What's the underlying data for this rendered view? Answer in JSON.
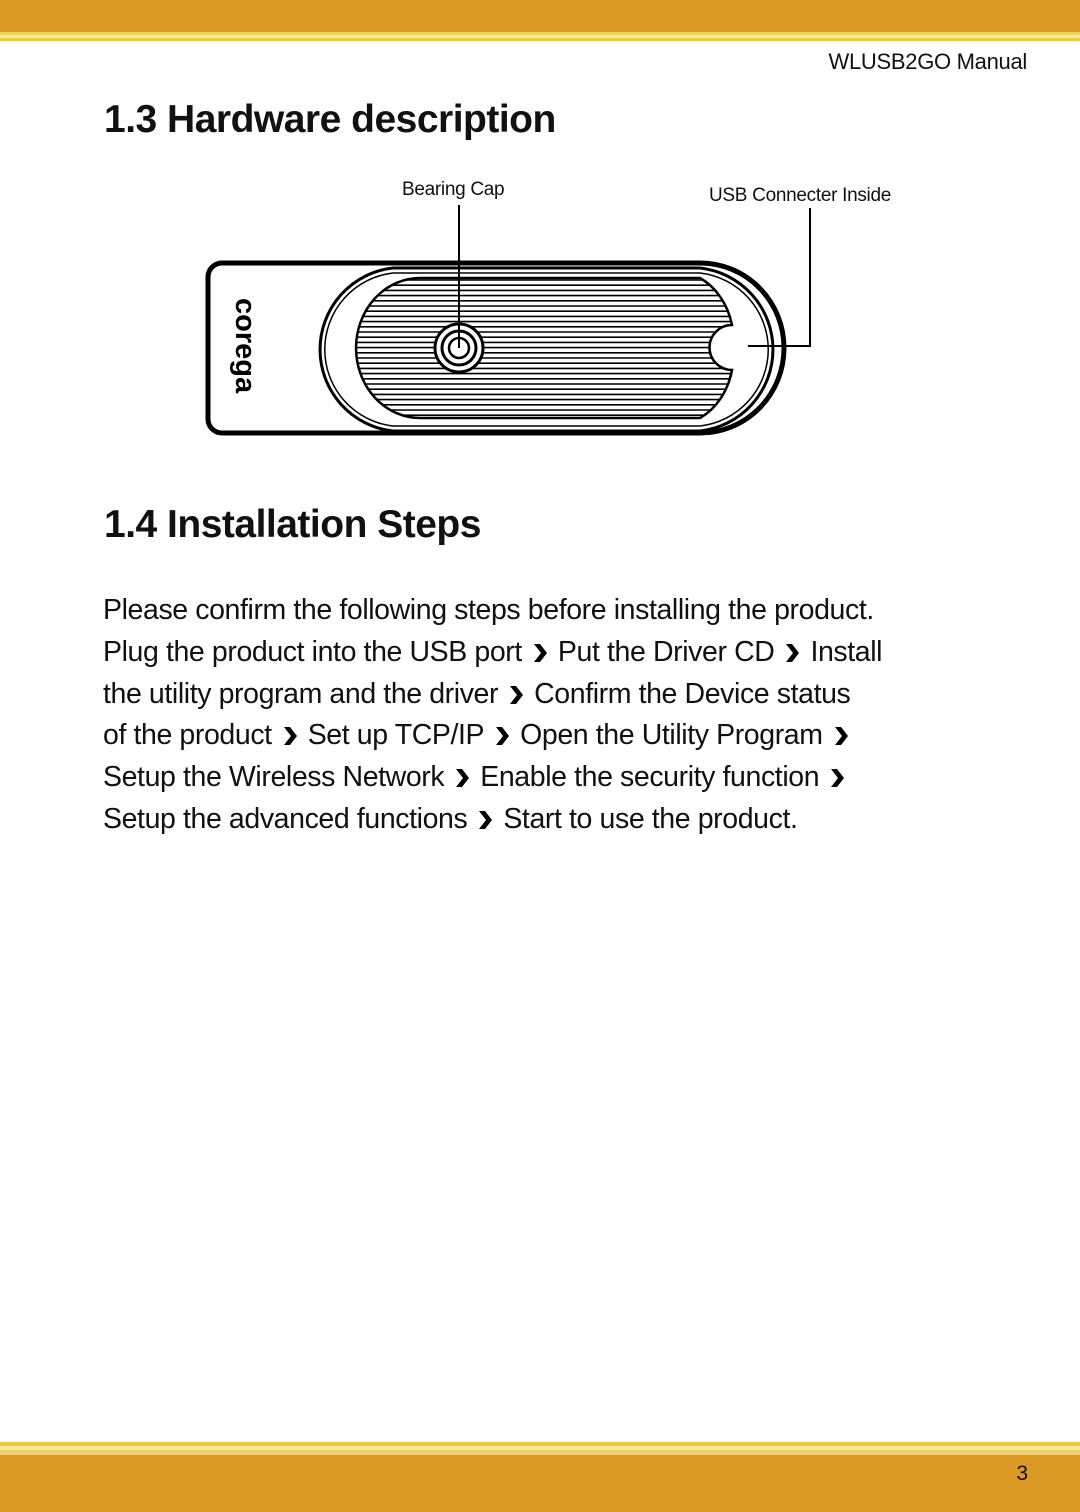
{
  "header": {
    "title": "WLUSB2GO  Manual"
  },
  "colors": {
    "band": "#da9a24",
    "stripe_light": "#f4e27a",
    "stripe_mid": "#eccb4a"
  },
  "hardware": {
    "heading": "1.3 Hardware description",
    "labels": {
      "bearing_cap": "Bearing Cap",
      "usb": "USB Connecter Inside"
    },
    "logo": "corega"
  },
  "install": {
    "heading": "1.4 Installation Steps",
    "lines": [
      [
        "Please confirm the following steps before installing the product."
      ],
      [
        "Plug the product into the USB port",
        ">",
        "Put the Driver CD",
        ">",
        "Install"
      ],
      [
        "the utility program and the driver",
        ">",
        "Confirm the Device status"
      ],
      [
        "of the product",
        ">",
        "Set up TCP/IP",
        ">",
        "Open the Utility Program",
        ">"
      ],
      [
        "Setup the Wireless Network",
        ">",
        "Enable the security function",
        ">"
      ],
      [
        "Setup the advanced functions",
        ">",
        "Start to use the product."
      ]
    ]
  },
  "footer": {
    "page_number": "3"
  }
}
